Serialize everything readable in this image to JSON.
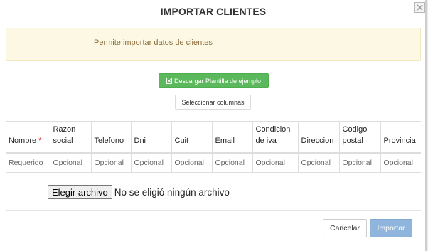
{
  "modal": {
    "title": "IMPORTAR CLIENTES",
    "close_icon": "close-icon"
  },
  "alert": {
    "text": "Permite importar datos de clientes",
    "color": "#fcf8e3"
  },
  "buttons": {
    "download_template": "Descargar Plantilla de ejemplo",
    "download_icon": "file-excel-icon",
    "select_columns": "Seleccionar columnas",
    "cancel": "Cancelar",
    "import": "Importar"
  },
  "table": {
    "headers": [
      {
        "label": "Nombre",
        "required": true
      },
      {
        "label": "Razon social",
        "required": false
      },
      {
        "label": "Telefono",
        "required": false
      },
      {
        "label": "Dni",
        "required": false
      },
      {
        "label": "Cuit",
        "required": false
      },
      {
        "label": "Email",
        "required": false
      },
      {
        "label": "Condicion de iva",
        "required": false
      },
      {
        "label": "Direccion",
        "required": false
      },
      {
        "label": "Codigo postal",
        "required": false
      },
      {
        "label": "Provincia",
        "required": false
      }
    ],
    "required_marker": "*",
    "row": [
      "Requerido",
      "Opcional",
      "Opcional",
      "Opcional",
      "Opcional",
      "Opcional",
      "Opcional",
      "Opcional",
      "Opcional",
      "Opcional"
    ]
  },
  "file_input": {
    "button_label": "Elegir archivo",
    "status": "No se eligió ningún archivo"
  },
  "colors": {
    "success": "#5cb85c",
    "primary_disabled": "#8fb5dc",
    "alert_text": "#8a6d3b",
    "required": "#d9534f"
  }
}
